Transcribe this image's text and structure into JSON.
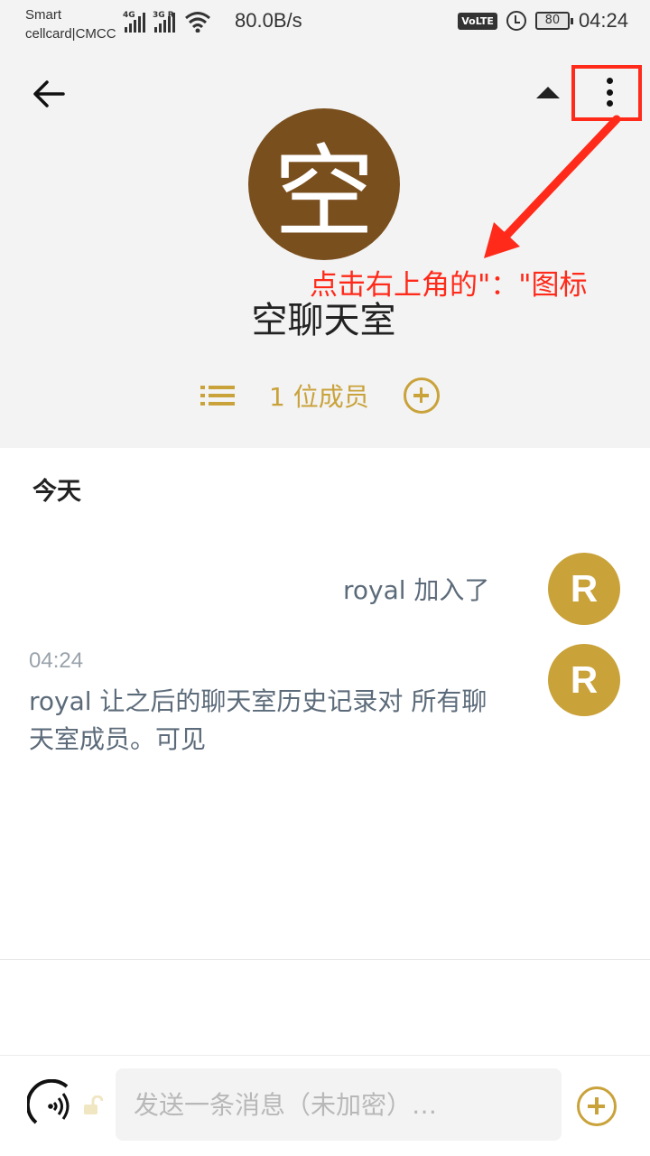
{
  "status_bar": {
    "carrier_line1": "Smart",
    "carrier_line2": "cellcard|CMCC",
    "signal1_tag": "4G",
    "signal2_tag": "3G R",
    "net_speed": "80.0B/s",
    "volte": "VoLTE",
    "battery": "80",
    "time": "04:24"
  },
  "header": {
    "avatar_letter": "空",
    "room_name": "空聊天室",
    "member_count": "1 位成员",
    "annotation": "点击右上角的\"：\"图标",
    "accent_color": "#c9a23a",
    "avatar_color": "#7a4f1e",
    "annotation_color": "#ff2a1a"
  },
  "timeline": {
    "day_label": "今天",
    "event1": {
      "text": "royal 加入了",
      "avatar_letter": "R"
    },
    "event2": {
      "timestamp": "04:24",
      "text": "royal 让之后的聊天室历史记录对 所有聊天室成员。可见",
      "avatar_letter": "R"
    }
  },
  "composer": {
    "placeholder": "发送一条消息（未加密）…"
  }
}
